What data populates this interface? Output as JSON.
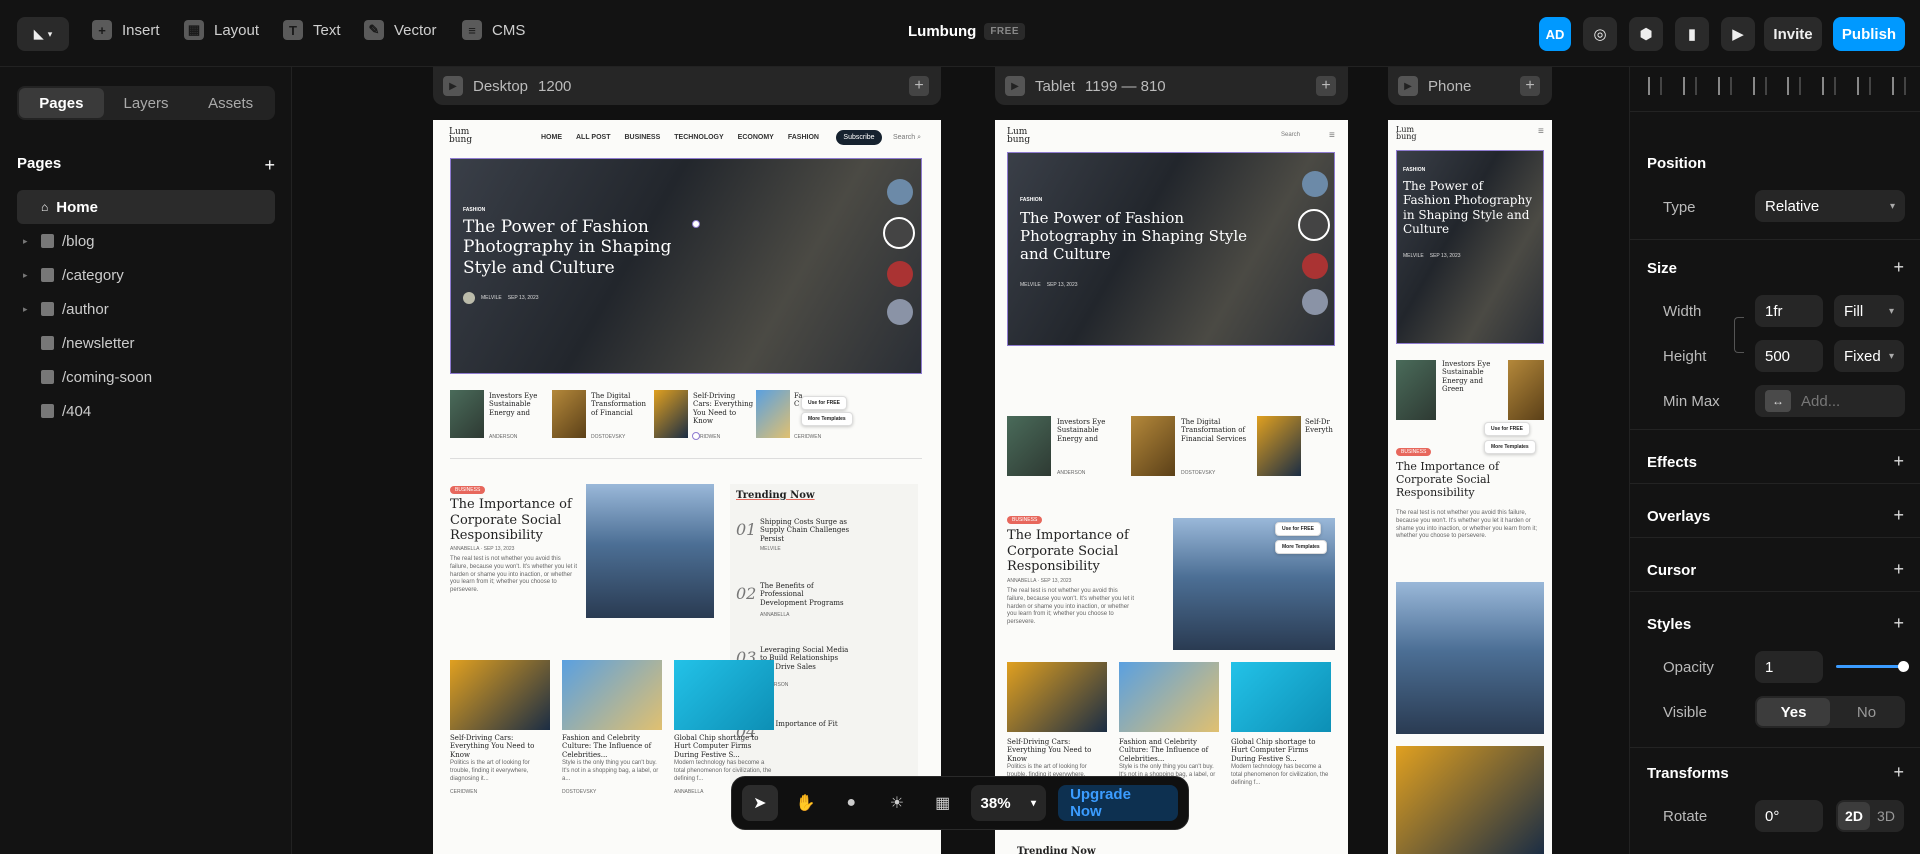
{
  "topbar": {
    "tools": [
      "Insert",
      "Layout",
      "Text",
      "Vector",
      "CMS"
    ],
    "project_title": "Lumbung",
    "plan_badge": "FREE",
    "avatar": "AD",
    "invite": "Invite",
    "publish": "Publish"
  },
  "left": {
    "tabs": [
      "Pages",
      "Layers",
      "Assets"
    ],
    "pages_header": "Pages",
    "pages": [
      {
        "label": "Home",
        "icon": "home-icon"
      },
      {
        "label": "/blog",
        "icon": "folder-icon"
      },
      {
        "label": "/category",
        "icon": "folder-icon"
      },
      {
        "label": "/author",
        "icon": "folder-icon"
      },
      {
        "label": "/newsletter",
        "icon": "page-icon"
      },
      {
        "label": "/coming-soon",
        "icon": "page-icon"
      },
      {
        "label": "/404",
        "icon": "page-icon"
      }
    ]
  },
  "frames": {
    "desktop": {
      "name": "Desktop",
      "size": "1200"
    },
    "tablet": {
      "name": "Tablet",
      "size": "1199 — 810"
    },
    "phone": {
      "name": "Phone",
      "size": ""
    }
  },
  "site": {
    "logo": "Lum bung",
    "nav": [
      "HOME",
      "ALL POST",
      "BUSINESS",
      "TECHNOLOGY",
      "ECONOMY",
      "FASHION"
    ],
    "subscribe": "Subscribe",
    "search": "Search",
    "hero_tag": "FASHION",
    "hero_title": "The Power of Fashion Photography in Shaping Style and Culture",
    "hero_author": "MELVILE",
    "hero_date": "SEP 13, 2023",
    "cards": [
      {
        "title": "Investors Eye Sustainable Energy and",
        "author": "ANDERSON"
      },
      {
        "title": "The Digital Transformation of Financial",
        "author": "DOSTOEVSKY"
      },
      {
        "title": "Self-Driving Cars: Everything You Need to Know",
        "author": "CERIDWEN"
      },
      {
        "title": "Fa C",
        "author": "CERIDWEN"
      }
    ],
    "use_free": "Use for FREE",
    "more_templates": "More Templates",
    "feature_tag": "BUSINESS",
    "feature_title": "The Importance of Corporate Social Responsibility",
    "feature_author": "ANNABELLA",
    "feature_date": "SEP 13, 2023",
    "feature_body": "The real test is not whether you avoid this failure, because you won't. It's whether you let it harden or shame you into inaction, or whether you learn from it; whether you choose to persevere.",
    "trending_title": "Trending Now",
    "trending": [
      {
        "num": "01",
        "title": "Shipping Costs Surge as Supply Chain Challenges Persist",
        "author": "MELVILE"
      },
      {
        "num": "02",
        "title": "The Benefits of Professional Development Programs",
        "author": "ANNABELLA"
      },
      {
        "num": "03",
        "title": "Leveraging Social Media to Build Relationships and Drive Sales",
        "author": "ANDERSON"
      },
      {
        "num": "04",
        "title": "The Importance of Fit",
        "author": ""
      }
    ],
    "grid": [
      {
        "title": "Self-Driving Cars: Everything You Need to Know",
        "body": "Politics is the art of looking for trouble, finding it everywhere, diagnosing it...",
        "author": "CERIDWEN"
      },
      {
        "title": "Fashion and Celebrity Culture: The Influence of Celebrities...",
        "body": "Style is the only thing you can't buy. It's not in a shopping bag, a label, or a...",
        "author": "DOSTOEVSKY"
      },
      {
        "title": "Global Chip shortage to Hurt Computer Firms During Festive S...",
        "body": "Modern technology has become a total phenomenon for civilization, the defining f...",
        "author": "ANNABELLA"
      }
    ],
    "tablet_card3": "Self-Dr Everyth",
    "tablet_card2": "The Digital Transformation of Financial Services",
    "phone_card": "Investors Eye Sustainable Energy and Green",
    "trending_bottom": "Trending Now"
  },
  "toolbar": {
    "zoom": "38%",
    "upgrade": "Upgrade Now"
  },
  "right": {
    "position": {
      "title": "Position",
      "type_label": "Type",
      "type_value": "Relative"
    },
    "size": {
      "title": "Size",
      "width_label": "Width",
      "width_value": "1fr",
      "width_mode": "Fill",
      "height_label": "Height",
      "height_value": "500",
      "height_mode": "Fixed",
      "minmax_label": "Min Max",
      "minmax_placeholder": "Add..."
    },
    "effects": "Effects",
    "overlays": "Overlays",
    "cursor": "Cursor",
    "styles": {
      "title": "Styles",
      "opacity_label": "Opacity",
      "opacity_value": "1",
      "opacity_level": 1.0,
      "visible_label": "Visible",
      "yes": "Yes",
      "no": "No"
    },
    "transforms": {
      "title": "Transforms",
      "rotate_label": "Rotate",
      "rotate_value": "0°",
      "mode_2d": "2D",
      "mode_3d": "3D"
    }
  },
  "colors": {
    "accent": "#0099ff",
    "hero_border": "#8e7bd0",
    "tag": "#e7675c"
  }
}
